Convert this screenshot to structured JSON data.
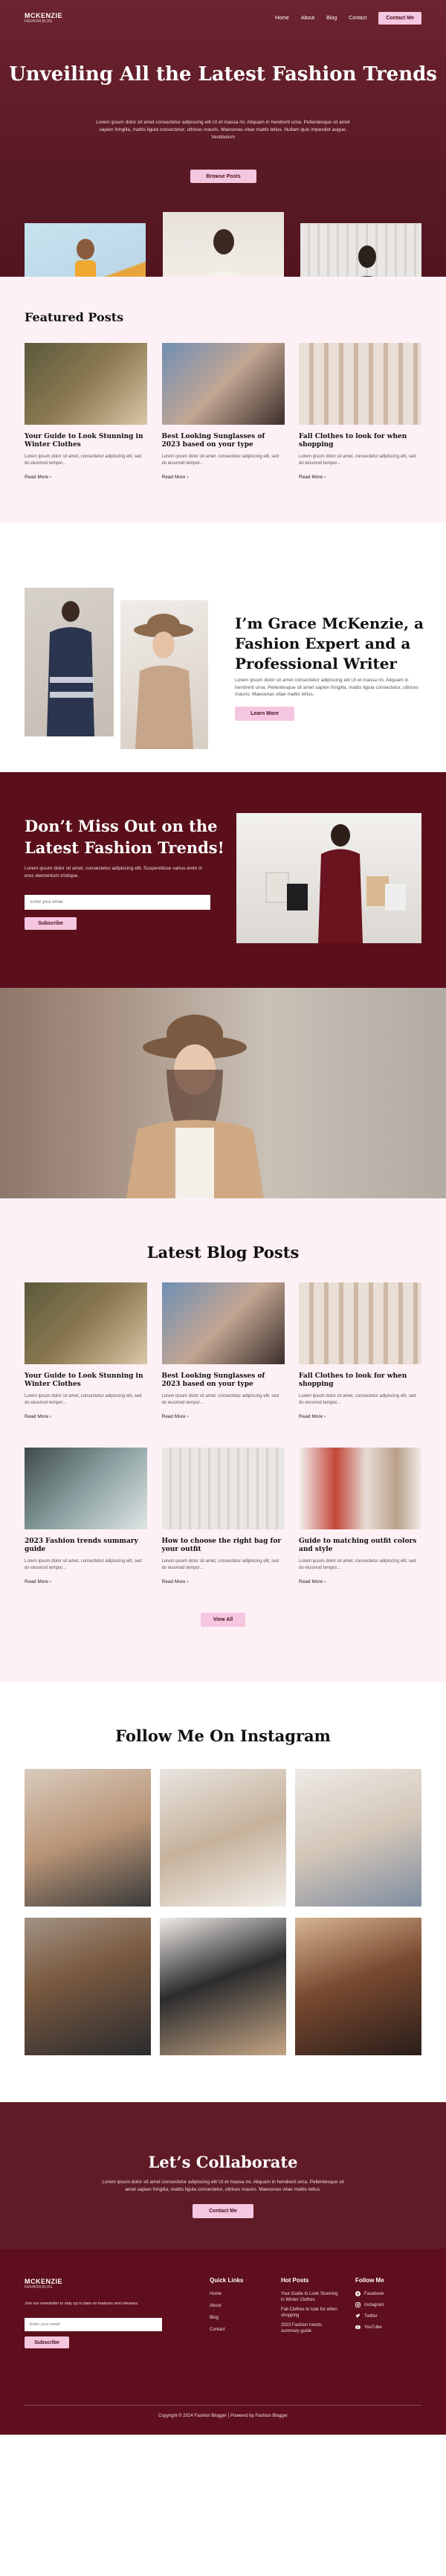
{
  "nav": {
    "brand_name": "MCKENZIE",
    "brand_sub": "FASHION BLOG",
    "links": [
      "Home",
      "About",
      "Blog",
      "Contact"
    ],
    "cta": "Contact Me"
  },
  "hero": {
    "title": "Unveiling All the Latest Fashion Trends",
    "lead": "Lorem ipsum dolor sit amet consectetur adipiscing elit Ut et massa mi. Aliquam in hendrerit urna. Pellentesque sit amet sapien fringilla, mattis ligula consectetur, ultrices mauris. Maecenas vitae mattis tellus. Nullam quis imperdiet augue. Vestibulum",
    "button": "Browse Posts"
  },
  "featured": {
    "title": "Featured Posts",
    "posts": [
      {
        "title": "Your Guide to Look Stunning in Winter Clothes",
        "excerpt": "Lorem ipsum dolor sit amet, consectetur adipiscing elit, sed do eiusmod tempor...",
        "more": "Read More"
      },
      {
        "title": "Best Looking Sunglasses of 2023 based on your type",
        "excerpt": "Lorem ipsum dolor sit amet, consectetur adipiscing elit, sed do eiusmod tempor...",
        "more": "Read More"
      },
      {
        "title": "Fall Clothes to look for when shopping",
        "excerpt": "Lorem ipsum dolor sit amet, consectetur adipiscing elit, sed do eiusmod tempor...",
        "more": "Read More"
      }
    ]
  },
  "about": {
    "title": "I’m Grace McKenzie, a Fashion Expert and a Professional Writer",
    "text": "Lorem ipsum dolor sit amet consectetur adipiscing elit Ut et massa mi. Aliquam in hendrerit urna. Pellentesque sit amet sapien fringilla, mattis ligula consectetur, ultrices mauris. Maecenas vitae mattis tellus.",
    "button": "Learn More"
  },
  "newsletter": {
    "title": "Don’t Miss Out on the Latest Fashion Trends!",
    "text": "Lorem ipsum dolor sit amet, consectetur adipiscing elit. Suspendisse varius enim in eros elementum tristique.",
    "placeholder": "Enter your email",
    "button": "Subscribe"
  },
  "latest": {
    "title": "Latest Blog Posts",
    "posts": [
      {
        "title": "Your Guide to Look Stunning in Winter Clothes",
        "excerpt": "Lorem ipsum dolor sit amet, consectetur adipiscing elit, sed do eiusmod tempor...",
        "more": "Read More"
      },
      {
        "title": "Best Looking Sunglasses of 2023 based on your type",
        "excerpt": "Lorem ipsum dolor sit amet, consectetur adipiscing elit, sed do eiusmod tempor...",
        "more": "Read More"
      },
      {
        "title": "Fall Clothes to look for when shopping",
        "excerpt": "Lorem ipsum dolor sit amet, consectetur adipiscing elit, sed do eiusmod tempor...",
        "more": "Read More"
      },
      {
        "title": "2023 Fashion trends summary guide",
        "excerpt": "Lorem ipsum dolor sit amet, consectetur adipiscing elit, sed do eiusmod tempor...",
        "more": "Read More"
      },
      {
        "title": "How to choose the right bag for your outfit",
        "excerpt": "Lorem ipsum dolor sit amet, consectetur adipiscing elit, sed do eiusmod tempor...",
        "more": "Read More"
      },
      {
        "title": "Guide to matching outfit colors and style",
        "excerpt": "Lorem ipsum dolor sit amet, consectetur adipiscing elit, sed do eiusmod tempor...",
        "more": "Read More"
      }
    ],
    "button": "View All"
  },
  "instagram": {
    "title": "Follow Me On Instagram"
  },
  "collab": {
    "title": "Let’s Collaborate",
    "text": "Lorem ipsum dolor sit amet consectetur adipiscing elit Ut et massa mi. Aliquam in hendrerit urna. Pellentesque sit amet sapien fringilla, mattis ligula consectetur, ultrices mauris. Maecenas vitae mattis tellus.",
    "button": "Contact Me"
  },
  "footer": {
    "brand_name": "MCKENZIE",
    "brand_sub": "FASHION BLOG",
    "desc": "Join our newsletter to stay up to date on features and releases.",
    "placeholder": "Enter your email",
    "button": "Subscribe",
    "quick_title": "Quick Links",
    "quick_links": [
      "Home",
      "About",
      "Blog",
      "Contact"
    ],
    "posts_title": "Hot Posts",
    "posts": [
      "Your Guide to Look Stunning in Winter Clothes",
      "Fall Clothes to look for when shopping",
      "2023 Fashion trends summary guide"
    ],
    "social_title": "Follow Me",
    "social": [
      "Facebook",
      "Instagram",
      "Twitter",
      "YouTube"
    ],
    "copyright": "Copyright © 2024 Fashion Blogger | Powered by Fashion Blogger"
  },
  "colors": {
    "burgundy": "#5e0e1c",
    "hero": "#6d2330",
    "pink_accent": "#f5c6df",
    "pink_bg": "#fdf1f6"
  }
}
